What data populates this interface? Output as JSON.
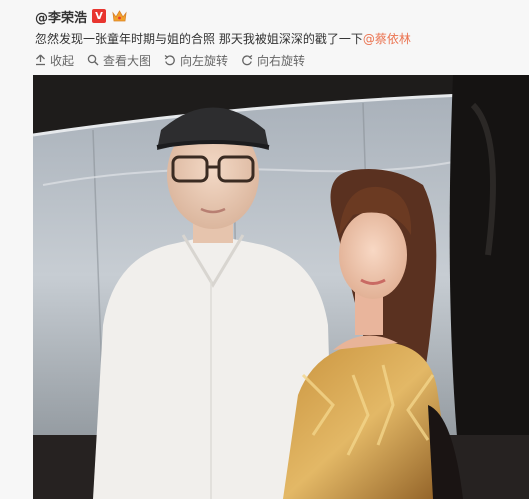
{
  "post": {
    "username": "@李荣浩",
    "badges": [
      "verified-v-badge",
      "crown-badge"
    ],
    "text": "忽然发现一张童年时期与姐的合照  那天我被姐深深的戳了一下",
    "mention": "@蔡依林"
  },
  "toolbar": {
    "collapse_label": "收起",
    "view_large_label": "查看大图",
    "rotate_left_label": "向左旋转",
    "rotate_right_label": "向右旋转"
  },
  "colors": {
    "accent": "#eb7350",
    "verified": "#e8352f",
    "text": "#333333",
    "secondary": "#666666",
    "background": "#f7f7f7"
  },
  "icons": [
    "collapse-icon",
    "magnifier-icon",
    "rotate-left-icon",
    "rotate-right-icon"
  ]
}
